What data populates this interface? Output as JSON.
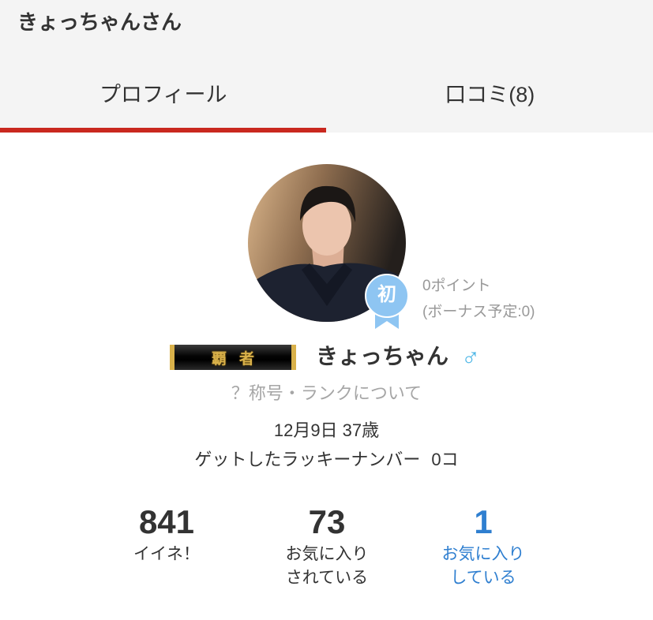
{
  "header": {
    "title": "きょっちゃんさん"
  },
  "tabs": [
    {
      "label": "プロフィール",
      "active": true
    },
    {
      "label": "口コミ(8)",
      "active": false
    }
  ],
  "profile": {
    "badge_char": "初",
    "points": "0ポイント",
    "bonus": "(ボーナス予定:0)",
    "rank_title": "覇者",
    "name": "きょっちゃん",
    "gender_symbol": "♂",
    "gender_icon": "male-icon",
    "rank_help": "？称号・ランクについて",
    "birthday_age": "12月9日 37歳",
    "lucky_number_label": "ゲットしたラッキーナンバー",
    "lucky_number_value": "0コ"
  },
  "stats": [
    {
      "value": "841",
      "label_lines": [
        "イイネ！"
      ]
    },
    {
      "value": "73",
      "label_lines": [
        "お気に入り",
        "されている"
      ]
    },
    {
      "value": "1",
      "label_lines": [
        "お気に入り",
        "している"
      ]
    }
  ],
  "colors": {
    "header_bg": "#f4f4f4",
    "active_tab_underline": "#c9281f",
    "text": "#333333",
    "muted": "#999999",
    "link_blue": "#2f7fd0",
    "gender_blue": "#4cb6e6",
    "badge_blue": "#8ec5f2",
    "gold": "#d9b14a"
  }
}
